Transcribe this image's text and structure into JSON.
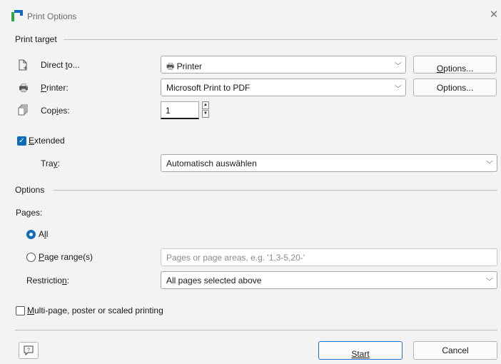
{
  "window": {
    "title": "Print Options",
    "accent": "#0f6cbd"
  },
  "print_target": {
    "section_title": "Print target",
    "direct_to": {
      "label_pre": "Direct ",
      "label_u": "t",
      "label_post": "o...",
      "value": "Printer",
      "options_label_pre": "",
      "options_label_u": "O",
      "options_label_post": "ptions..."
    },
    "printer": {
      "label_pre": "",
      "label_u": "P",
      "label_post": "rinter:",
      "value": "Microsoft Print to PDF",
      "options_label": "Options..."
    },
    "copies": {
      "label_pre": "Cop",
      "label_u": "i",
      "label_post": "es:",
      "value": "1"
    },
    "extended": {
      "label_pre": "",
      "label_u": "E",
      "label_post": "xtended",
      "checked": true
    },
    "tray": {
      "label_pre": "Tra",
      "label_u": "y",
      "label_post": ":",
      "value": "Automatisch auswählen"
    }
  },
  "options": {
    "section_title": "Options",
    "pages_label": "Pages:",
    "all": {
      "label_pre": "A",
      "label_u": "l",
      "label_post": "l",
      "selected": true
    },
    "page_range": {
      "label_pre": "",
      "label_u": "P",
      "label_post": "age range(s)",
      "selected": false,
      "placeholder": "Pages or page areas, e.g. '1,3-5,20-'"
    },
    "restriction": {
      "label_pre": "Restrictio",
      "label_u": "n",
      "label_post": ":",
      "value": "All pages selected above"
    },
    "multipage": {
      "label_pre": "",
      "label_u": "M",
      "label_post": "ulti-page, poster or scaled printing",
      "checked": false
    }
  },
  "footer": {
    "help_icon": "help-icon",
    "start_label": "Start",
    "cancel_label": "Cancel"
  }
}
